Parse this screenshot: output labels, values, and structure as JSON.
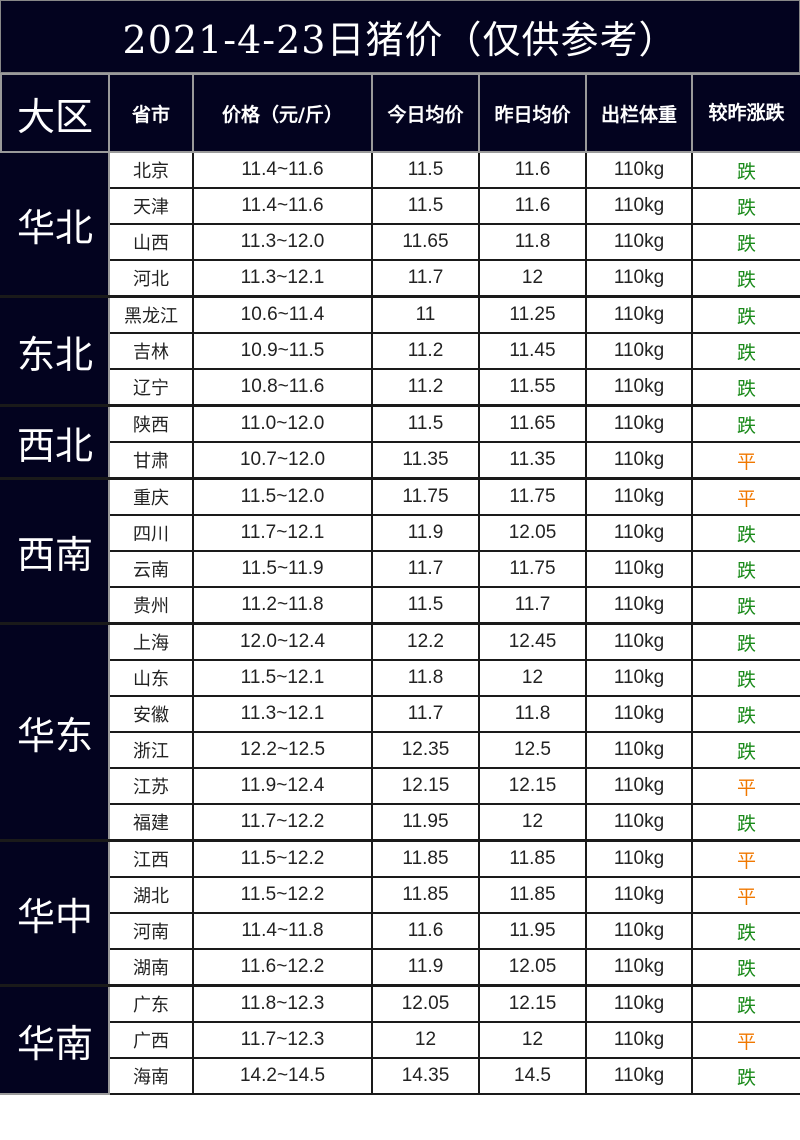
{
  "title": "2021-4-23日猪价（仅供参考）",
  "colors": {
    "header_bg": "#03031f",
    "fall": "#1a8a1a",
    "flat": "#f07800"
  },
  "headers": [
    "大区",
    "省市",
    "价格（元/斤）",
    "今日均价",
    "昨日均价",
    "出栏体重",
    "较昨涨跌"
  ],
  "regions": [
    {
      "name": "华北",
      "rows": [
        {
          "province": "北京",
          "range": "11.4~11.6",
          "today": "11.5",
          "yesterday": "11.6",
          "weight": "110kg",
          "trend": "跌"
        },
        {
          "province": "天津",
          "range": "11.4~11.6",
          "today": "11.5",
          "yesterday": "11.6",
          "weight": "110kg",
          "trend": "跌"
        },
        {
          "province": "山西",
          "range": "11.3~12.0",
          "today": "11.65",
          "yesterday": "11.8",
          "weight": "110kg",
          "trend": "跌"
        },
        {
          "province": "河北",
          "range": "11.3~12.1",
          "today": "11.7",
          "yesterday": "12",
          "weight": "110kg",
          "trend": "跌"
        }
      ]
    },
    {
      "name": "东北",
      "rows": [
        {
          "province": "黑龙江",
          "range": "10.6~11.4",
          "today": "11",
          "yesterday": "11.25",
          "weight": "110kg",
          "trend": "跌"
        },
        {
          "province": "吉林",
          "range": "10.9~11.5",
          "today": "11.2",
          "yesterday": "11.45",
          "weight": "110kg",
          "trend": "跌"
        },
        {
          "province": "辽宁",
          "range": "10.8~11.6",
          "today": "11.2",
          "yesterday": "11.55",
          "weight": "110kg",
          "trend": "跌"
        }
      ]
    },
    {
      "name": "西北",
      "rows": [
        {
          "province": "陕西",
          "range": "11.0~12.0",
          "today": "11.5",
          "yesterday": "11.65",
          "weight": "110kg",
          "trend": "跌"
        },
        {
          "province": "甘肃",
          "range": "10.7~12.0",
          "today": "11.35",
          "yesterday": "11.35",
          "weight": "110kg",
          "trend": "平"
        }
      ]
    },
    {
      "name": "西南",
      "rows": [
        {
          "province": "重庆",
          "range": "11.5~12.0",
          "today": "11.75",
          "yesterday": "11.75",
          "weight": "110kg",
          "trend": "平"
        },
        {
          "province": "四川",
          "range": "11.7~12.1",
          "today": "11.9",
          "yesterday": "12.05",
          "weight": "110kg",
          "trend": "跌"
        },
        {
          "province": "云南",
          "range": "11.5~11.9",
          "today": "11.7",
          "yesterday": "11.75",
          "weight": "110kg",
          "trend": "跌"
        },
        {
          "province": "贵州",
          "range": "11.2~11.8",
          "today": "11.5",
          "yesterday": "11.7",
          "weight": "110kg",
          "trend": "跌"
        }
      ]
    },
    {
      "name": "华东",
      "rows": [
        {
          "province": "上海",
          "range": "12.0~12.4",
          "today": "12.2",
          "yesterday": "12.45",
          "weight": "110kg",
          "trend": "跌"
        },
        {
          "province": "山东",
          "range": "11.5~12.1",
          "today": "11.8",
          "yesterday": "12",
          "weight": "110kg",
          "trend": "跌"
        },
        {
          "province": "安徽",
          "range": "11.3~12.1",
          "today": "11.7",
          "yesterday": "11.8",
          "weight": "110kg",
          "trend": "跌"
        },
        {
          "province": "浙江",
          "range": "12.2~12.5",
          "today": "12.35",
          "yesterday": "12.5",
          "weight": "110kg",
          "trend": "跌"
        },
        {
          "province": "江苏",
          "range": "11.9~12.4",
          "today": "12.15",
          "yesterday": "12.15",
          "weight": "110kg",
          "trend": "平"
        },
        {
          "province": "福建",
          "range": "11.7~12.2",
          "today": "11.95",
          "yesterday": "12",
          "weight": "110kg",
          "trend": "跌"
        }
      ]
    },
    {
      "name": "华中",
      "rows": [
        {
          "province": "江西",
          "range": "11.5~12.2",
          "today": "11.85",
          "yesterday": "11.85",
          "weight": "110kg",
          "trend": "平"
        },
        {
          "province": "湖北",
          "range": "11.5~12.2",
          "today": "11.85",
          "yesterday": "11.85",
          "weight": "110kg",
          "trend": "平"
        },
        {
          "province": "河南",
          "range": "11.4~11.8",
          "today": "11.6",
          "yesterday": "11.95",
          "weight": "110kg",
          "trend": "跌"
        },
        {
          "province": "湖南",
          "range": "11.6~12.2",
          "today": "11.9",
          "yesterday": "12.05",
          "weight": "110kg",
          "trend": "跌"
        }
      ]
    },
    {
      "name": "华南",
      "rows": [
        {
          "province": "广东",
          "range": "11.8~12.3",
          "today": "12.05",
          "yesterday": "12.15",
          "weight": "110kg",
          "trend": "跌"
        },
        {
          "province": "广西",
          "range": "11.7~12.3",
          "today": "12",
          "yesterday": "12",
          "weight": "110kg",
          "trend": "平"
        },
        {
          "province": "海南",
          "range": "14.2~14.5",
          "today": "14.35",
          "yesterday": "14.5",
          "weight": "110kg",
          "trend": "跌"
        }
      ]
    }
  ]
}
